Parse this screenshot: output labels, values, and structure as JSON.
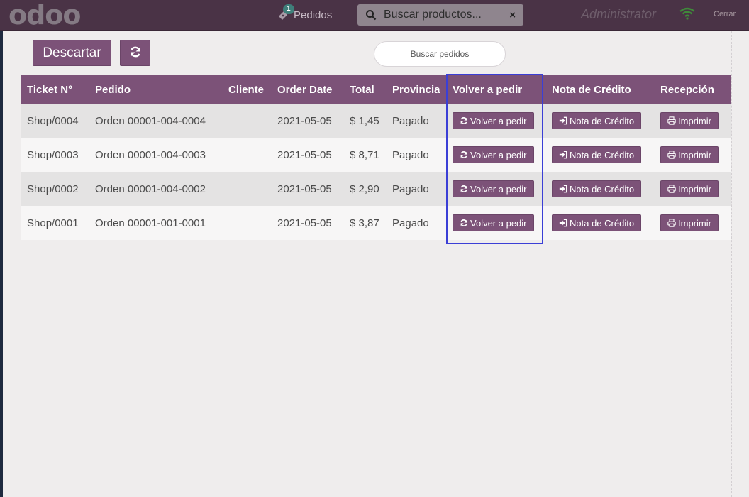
{
  "topbar": {
    "logo": "odoo",
    "orders_badge": "1",
    "orders_label": "Pedidos",
    "search_placeholder": "Buscar productos...",
    "clear_icon": "×",
    "user": "Administrator",
    "close_label": "Cerrar"
  },
  "toolbar": {
    "discard_label": "Descartar",
    "refresh_icon": "refresh-icon",
    "search_orders_placeholder": "Buscar pedidos"
  },
  "table": {
    "headers": [
      "Ticket N°",
      "Pedido",
      "Cliente",
      "Order Date",
      "Total",
      "Provincia",
      "Volver a pedir",
      "Nota de Crédito",
      "Recepción"
    ],
    "rows": [
      {
        "ticket": "Shop/0004",
        "pedido": "Orden 00001-004-0004",
        "cliente": "",
        "date": "2021-05-05",
        "total": "$ 1,45",
        "provincia": "Pagado"
      },
      {
        "ticket": "Shop/0003",
        "pedido": "Orden 00001-004-0003",
        "cliente": "",
        "date": "2021-05-05",
        "total": "$ 8,71",
        "provincia": "Pagado"
      },
      {
        "ticket": "Shop/0002",
        "pedido": "Orden 00001-004-0002",
        "cliente": "",
        "date": "2021-05-05",
        "total": "$ 2,90",
        "provincia": "Pagado"
      },
      {
        "ticket": "Shop/0001",
        "pedido": "Orden 00001-001-0001",
        "cliente": "",
        "date": "2021-05-05",
        "total": "$ 3,87",
        "provincia": "Pagado"
      }
    ],
    "reorder_label": "Volver a pedir",
    "credit_note_label": "Nota de Crédito",
    "print_label": "Imprimir"
  },
  "colors": {
    "brand": "#7c5278",
    "topbar": "#4a3346",
    "highlight": "#3b3fd6"
  }
}
